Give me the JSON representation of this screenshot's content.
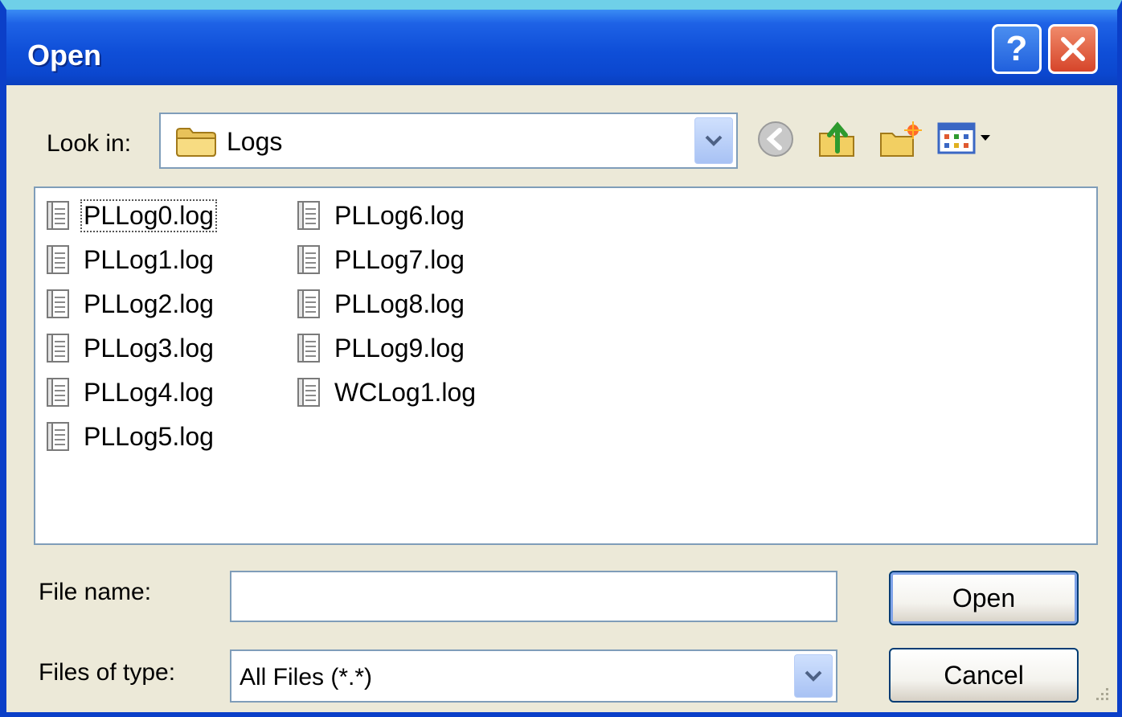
{
  "window": {
    "title": "Open",
    "help_glyph": "?",
    "colors": {
      "title_bar": "#0b47cf",
      "client_bg": "#ece9d8",
      "field_border": "#7f9db9"
    }
  },
  "look_in": {
    "label": "Look in:",
    "value": "Logs",
    "icon": "folder-icon"
  },
  "toolbar": {
    "items": [
      "back-icon",
      "up-folder-icon",
      "new-folder-icon",
      "view-menu-icon"
    ]
  },
  "files": [
    "PLLog0.log",
    "PLLog1.log",
    "PLLog2.log",
    "PLLog3.log",
    "PLLog4.log",
    "PLLog5.log",
    "PLLog6.log",
    "PLLog7.log",
    "PLLog8.log",
    "PLLog9.log",
    "WCLog1.log"
  ],
  "file_name": {
    "label": "File name:",
    "value": ""
  },
  "file_type": {
    "label": "Files of type:",
    "value": "All Files (*.*)"
  },
  "buttons": {
    "open": "Open",
    "cancel": "Cancel"
  }
}
